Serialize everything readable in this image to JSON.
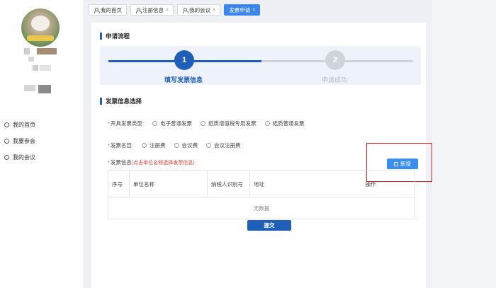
{
  "nav": {
    "items": [
      {
        "label": "我的首页"
      },
      {
        "label": "我要参会"
      },
      {
        "label": "我的会议"
      }
    ]
  },
  "tabs": [
    {
      "label": "我的首页",
      "closable": false,
      "active": false
    },
    {
      "label": "注册信息",
      "closable": true,
      "active": false
    },
    {
      "label": "我的会议",
      "closable": true,
      "active": false
    },
    {
      "label": "发票申请",
      "closable": true,
      "active": true
    }
  ],
  "close_glyph": "×",
  "process": {
    "title": "申请流程",
    "steps": [
      {
        "number": "1",
        "label": "填写发票信息",
        "status": "active"
      },
      {
        "number": "2",
        "label": "申请成功",
        "status": "pending"
      }
    ]
  },
  "invoice_select": {
    "title": "发票信息选择",
    "type_field": {
      "required_mark": "*",
      "label": "开具发票类型:",
      "options": [
        "电子普通发票",
        "纸质增值税专用发票",
        "纸质普通发票"
      ]
    },
    "name_field": {
      "required_mark": "*",
      "label": "发票名目:",
      "options": [
        "注册费",
        "会议费",
        "会议注册费"
      ]
    },
    "info_field": {
      "required_mark": "*",
      "label": "发票信息",
      "hint": "(点击单位名称选择发票信息)"
    },
    "add_button": "新增",
    "table": {
      "columns": [
        "序号",
        "单位名称",
        "纳税人识别号",
        "地址",
        "操作"
      ],
      "empty_text": "无数据"
    },
    "submit_button": "提交"
  },
  "colors": {
    "primary": "#1f5fb8",
    "accent": "#3a8ef0",
    "required": "#e23b3b",
    "highlight_border": "#e02525"
  }
}
